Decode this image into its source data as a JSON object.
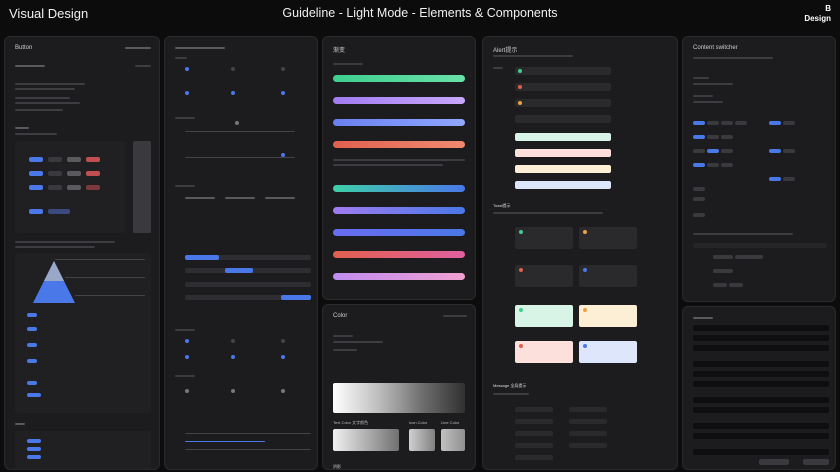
{
  "header": {
    "left_title": "Visual Design",
    "center_title": "Guideline - Light Mode - Elements & Components",
    "logo_line1": "B",
    "logo_line2": "Design"
  },
  "panels": {
    "button": {
      "title": "Button"
    },
    "gradients": {
      "title": "渐变"
    },
    "alerts": {
      "title": "Alert提示",
      "toast_title": "Toast提示",
      "message_title": "Message 全局提示"
    },
    "content_switcher": {
      "title": "Content switcher"
    },
    "color": {
      "title": "Color",
      "text_color_label": "Text Color 文字颜色",
      "icon_color_label": "Icon Color",
      "line_color_label": "Line Color",
      "shadow_label": "阴影"
    }
  },
  "colors": {
    "accent_blue": "#4a78e8",
    "green": "#3ecf8e",
    "purple": "#a07cf0",
    "red": "#e0604e",
    "orange": "#f0a040"
  }
}
